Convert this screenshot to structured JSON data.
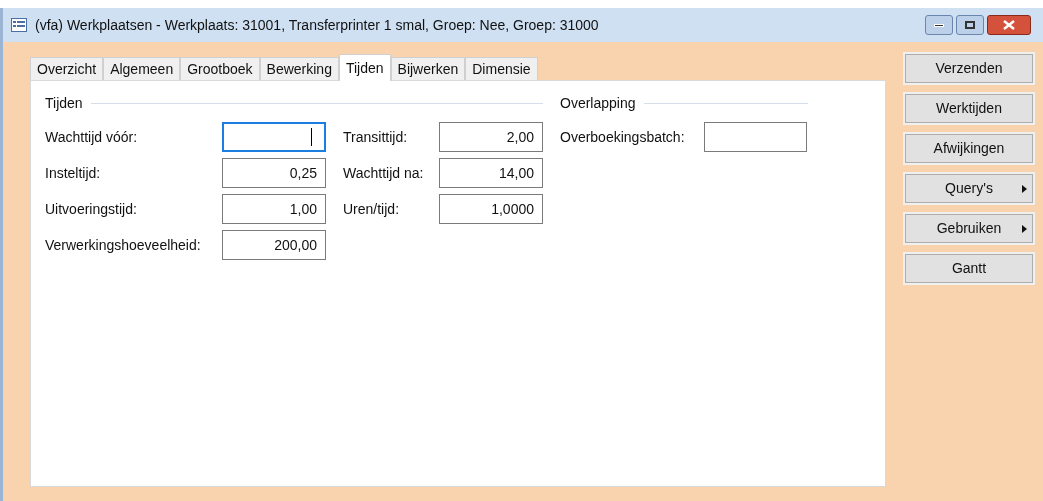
{
  "window": {
    "title": "(vfa) Werkplaatsen - Werkplaats: 31001, Transferprinter 1 smal, Groep: Nee, Groep: 31000"
  },
  "tabs": [
    {
      "label": "Overzicht",
      "selected": false
    },
    {
      "label": "Algemeen",
      "selected": false
    },
    {
      "label": "Grootboek",
      "selected": false
    },
    {
      "label": "Bewerking",
      "selected": false
    },
    {
      "label": "Tijden",
      "selected": true
    },
    {
      "label": "Bijwerken",
      "selected": false
    },
    {
      "label": "Dimensie",
      "selected": false
    }
  ],
  "groups": [
    {
      "title": "Tijden",
      "columns": [
        [
          {
            "label": "Wachttijd vóór:",
            "focused": true
          },
          {
            "label": "Insteltijd:",
            "value": "0,25",
            "focused": false
          },
          {
            "label": "Uitvoeringstijd:",
            "value": "1,00",
            "focused": false
          },
          {
            "label": "Verwerkingshoeveelheid:",
            "value": "200,00",
            "focused": false
          }
        ],
        [
          {
            "label": "Transittijd:",
            "value": "2,00",
            "focused": false
          },
          {
            "label": "Wachttijd na:",
            "value": "14,00",
            "focused": false
          },
          {
            "label": "Uren/tijd:",
            "value": "1,0000",
            "focused": false
          }
        ]
      ]
    },
    {
      "title": "Overlapping",
      "columns": [
        [
          {
            "label": "Overboekingsbatch:",
            "focused": false
          }
        ]
      ]
    }
  ],
  "buttons": [
    {
      "label": "Verzenden",
      "submenu": false
    },
    {
      "label": "Werktijden",
      "submenu": false
    },
    {
      "label": "Afwijkingen",
      "submenu": false
    },
    {
      "label": "Query's",
      "submenu": true
    },
    {
      "label": "Gebruiken",
      "submenu": true
    },
    {
      "label": "Gantt",
      "submenu": false
    }
  ]
}
